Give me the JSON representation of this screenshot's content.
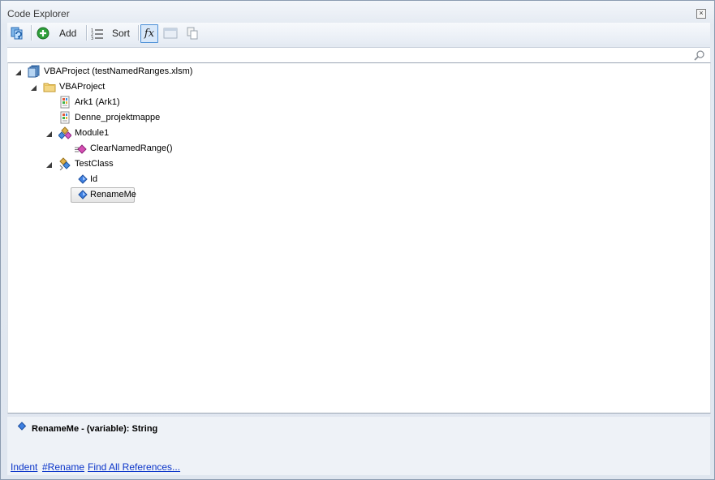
{
  "window": {
    "title": "Code Explorer",
    "close_glyph": "×"
  },
  "toolbar": {
    "refresh_icon": "refresh-icon",
    "add_label": "Add",
    "sort_label": "Sort",
    "fx_label": "fx"
  },
  "search": {
    "placeholder": ""
  },
  "tree": {
    "project": {
      "label": "VBAProject (testNamedRanges.xlsm)"
    },
    "folder": {
      "label": "VBAProject"
    },
    "sheet1": {
      "label": "Ark1 (Ark1)"
    },
    "workbook": {
      "label": "Denne_projektmappe"
    },
    "module1": {
      "label": "Module1"
    },
    "clear_named_range": {
      "label": "ClearNamedRange()"
    },
    "test_class": {
      "label": "TestClass"
    },
    "id_member": {
      "label": "Id"
    },
    "rename_member": {
      "label": "RenameMe"
    }
  },
  "details": {
    "selection_text": "RenameMe - (variable): String"
  },
  "actions": {
    "indent": "Indent",
    "rename": "#Rename",
    "find_refs": "Find All References..."
  },
  "colors": {
    "accent_blue": "#4a8ed6",
    "link": "#0b35c9",
    "field_icon": "#3d7fe0",
    "method_icon": "#d64fb3"
  }
}
